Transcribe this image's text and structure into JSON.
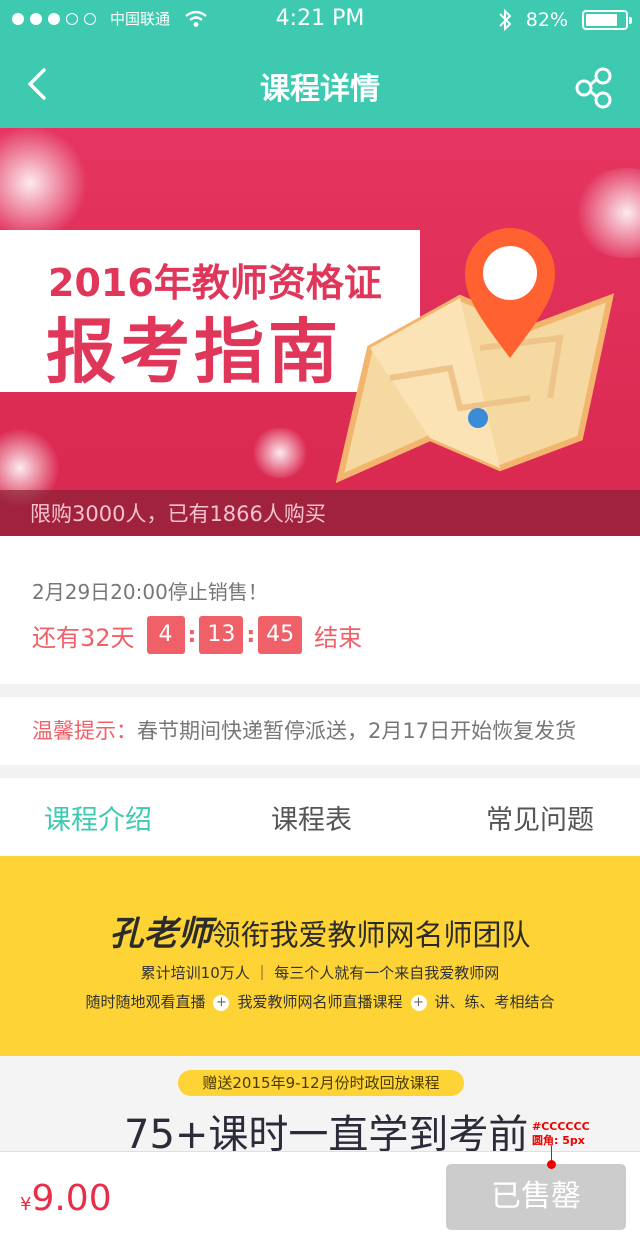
{
  "status_bar": {
    "carrier": "中国联通",
    "time": "4:21 PM",
    "battery": "82%",
    "battery_level": 0.82
  },
  "nav": {
    "title": "课程详情",
    "back_icon": "chevron-left-icon",
    "share_icon": "share-icon"
  },
  "banner": {
    "title_line1": "2016年教师资格证",
    "title_line2": "报考指南",
    "purchase_info": "限购3000人，已有1866人购买"
  },
  "countdown": {
    "stop_text": "2月29日20:00停止销售！",
    "remaining": "还有32天",
    "hours": "4",
    "minutes": "13",
    "seconds": "45",
    "end_label": "结束",
    "sep": ":"
  },
  "tip": {
    "label": "温馨提示：",
    "text": "春节期间快递暂停派送，2月17日开始恢复发货"
  },
  "tabs": [
    "课程介绍",
    "课程表",
    "常见问题"
  ],
  "promo": {
    "signature": "孔老师",
    "headline": "领衔我爱教师网名师团队",
    "line2": "累计培训10万人 ｜ 每三个人就有一个来自我爱教师网",
    "line3_a": "随时随地观看直播",
    "line3_b": "我爱教师网名师直播课程",
    "line3_c": "讲、练、考相结合",
    "plus": "+"
  },
  "gift": {
    "pill": "赠送2015年9-12月份时政回放课程",
    "big": "75+课时一直学到考前"
  },
  "annotation": {
    "line1": "#CCCCCC",
    "line2": "圆角: 5px"
  },
  "bottom": {
    "currency": "¥",
    "price": "9.00",
    "button": "已售罄"
  },
  "colors": {
    "accent": "#3ecab1",
    "price": "#e82d48",
    "button_disabled": "#cccccc",
    "banner": "#e53560",
    "promo_bg": "#fdd335"
  }
}
